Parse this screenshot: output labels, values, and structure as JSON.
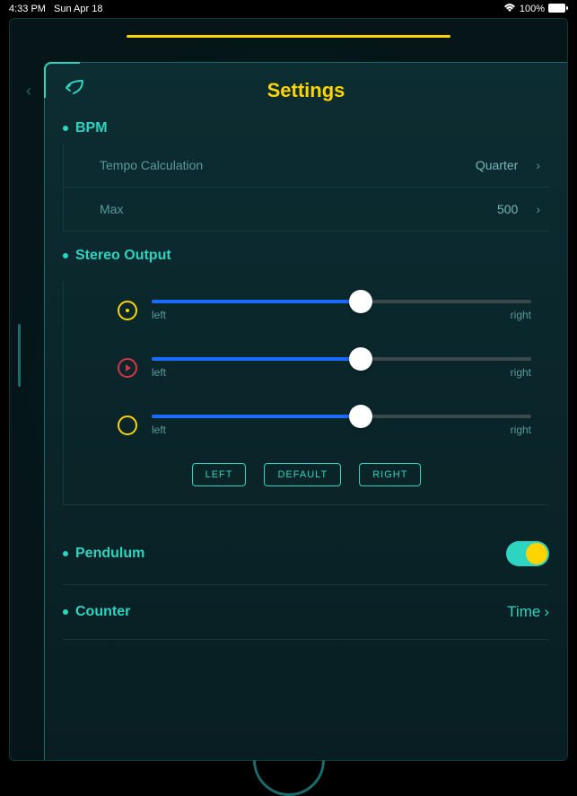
{
  "status": {
    "time": "4:33 PM",
    "date": "Sun Apr 18",
    "battery": "100%"
  },
  "title": "Settings",
  "bpm": {
    "header": "BPM",
    "tempo_label": "Tempo Calculation",
    "tempo_value": "Quarter",
    "max_label": "Max",
    "max_value": "500"
  },
  "stereo": {
    "header": "Stereo Output",
    "left_label": "left",
    "right_label": "right",
    "sliders": [
      {
        "position": 55
      },
      {
        "position": 55
      },
      {
        "position": 55
      }
    ],
    "preset_left": "LEFT",
    "preset_default": "DEFAULT",
    "preset_right": "RIGHT"
  },
  "pendulum": {
    "header": "Pendulum",
    "enabled": true
  },
  "counter": {
    "header": "Counter",
    "value": "Time"
  }
}
